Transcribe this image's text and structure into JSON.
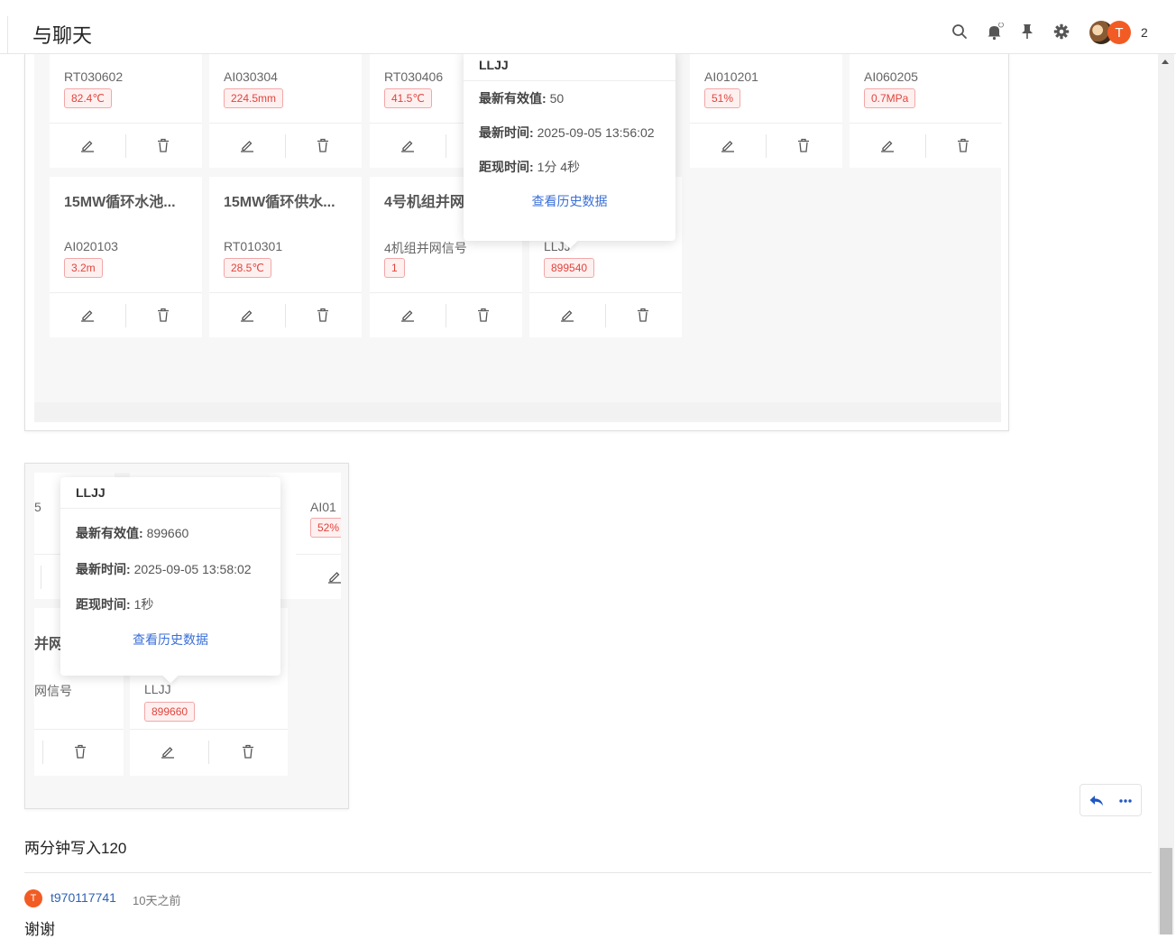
{
  "header": {
    "title": "与聊天",
    "icons": [
      "search-icon",
      "bell-icon",
      "pin-icon",
      "gear-icon"
    ],
    "badge_count": "2",
    "avatar_letter": "T"
  },
  "screenshot1": {
    "cards": [
      {
        "code": "RT030602",
        "value": "82.4℃"
      },
      {
        "code": "AI030304",
        "value": "224.5mm"
      },
      {
        "code": "RT030406",
        "value": "41.5℃"
      },
      {
        "code": "AI010201",
        "value": "51%"
      },
      {
        "code": "AI060205",
        "value": "0.7MPa"
      },
      {
        "title": "15MW循环水池...",
        "code": "AI020103",
        "value": "3.2m"
      },
      {
        "title": "15MW循环供水...",
        "code": "RT010301",
        "value": "28.5℃"
      },
      {
        "title": "4号机组并网",
        "code": "4机组并网信号",
        "value": "1"
      },
      {
        "code": "LLJJ",
        "value": "899540"
      }
    ],
    "tooltip": {
      "title": "LLJJ",
      "latest_label": "最新有效值:",
      "latest_value": "50",
      "time_label": "最新时间:",
      "time_value": "2025-09-05 13:56:02",
      "ago_label": "距现时间:",
      "ago_value": "1分 4秒",
      "link": "查看历史数据"
    }
  },
  "screenshot2": {
    "cards": [
      {
        "code": "5"
      },
      {
        "code": "AI01",
        "value": "52%"
      },
      {
        "title": "并网",
        "code": "网信号"
      },
      {
        "code": "LLJJ",
        "value": "899660"
      }
    ],
    "tooltip": {
      "title": "LLJJ",
      "latest_label": "最新有效值:",
      "latest_value": "899660",
      "time_label": "最新时间:",
      "time_value": "2025-09-05 13:58:02",
      "ago_label": "距现时间:",
      "ago_value": "1秒",
      "link": "查看历史数据"
    }
  },
  "post": {
    "text": "两分钟写入120",
    "actions": [
      "reply-icon",
      "more-icon"
    ]
  },
  "reply": {
    "avatar_letter": "T",
    "username": "t970117741",
    "time": "10天之前",
    "text": "谢谢"
  },
  "colors": {
    "accent": "#f25c24",
    "link": "#3a6fd8",
    "value_red": "#e0443c"
  }
}
